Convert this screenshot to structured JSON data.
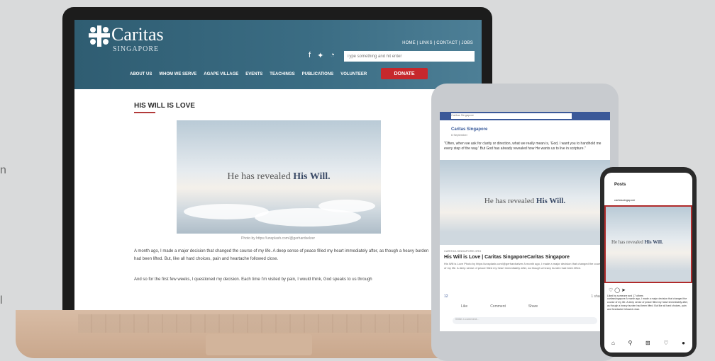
{
  "edge_letters": [
    "n",
    "l"
  ],
  "website": {
    "logo": {
      "name": "Caritas",
      "sub": "SINGAPORE"
    },
    "top_links": "HOME | LINKS | CONTACT | JOBS",
    "search_placeholder": "Type something and hit enter",
    "nav": [
      "ABOUT US",
      "WHOM WE SERVE",
      "AGAPE VILLAGE",
      "EVENTS",
      "TEACHINGS",
      "PUBLICATIONS",
      "VOLUNTEER"
    ],
    "donate_label": "DONATE",
    "page_title": "HIS WILL IS LOVE",
    "hero_text_plain": "He has revealed ",
    "hero_text_bold": "His Will.",
    "caption": "Photo by https://unsplash.com/@gerhardselzer",
    "para1": "A month ago, I made a major decision that changed the course of my life. A deep sense of peace filled my heart immediately after, as though a heavy burden had been lifted. But, like all hard choices, pain and heartache followed close.",
    "para2": "And so for the first few weeks, I questioned my decision. Each time I'm visited by pain, I would think, God speaks to us through"
  },
  "facebook": {
    "search": "Caritas Singapore",
    "page_name": "Caritas Singapore",
    "post_meta": "6 September",
    "post_text": "\"Often, when we ask for clarity or direction, what we really mean is, 'God, I want you to handhold me every step of the way.' But God has already revealed how He wants us to live in scripture.\"",
    "link_source": "CARITAS-SINGAPORE.ORG",
    "headline": "His Will is Love | Caritas SingaporeCaritas Singapore",
    "desc": "His Will is Love Photo by https://unsplash.com/@gerhardselzer A month ago, I made a major decision that changed the course of my life. A deep sense of peace filled my heart immediately after, as though a heavy burden had been lifted.",
    "reactions": "12",
    "shares": "1 share",
    "actions": [
      "Like",
      "Comment",
      "Share"
    ],
    "comment_placeholder": "Write a comment..."
  },
  "instagram": {
    "title": "Posts",
    "username": "caritassingapore",
    "liked_by": "Liked by someone and 17 others",
    "caption": "caritassingapore A month ago, I made a major decision that changed the course of my life. A deep sense of peace filled my heart immediately after, as though a heavy burden had been lifted. But like all hard choices, pain and heartache followed close."
  }
}
